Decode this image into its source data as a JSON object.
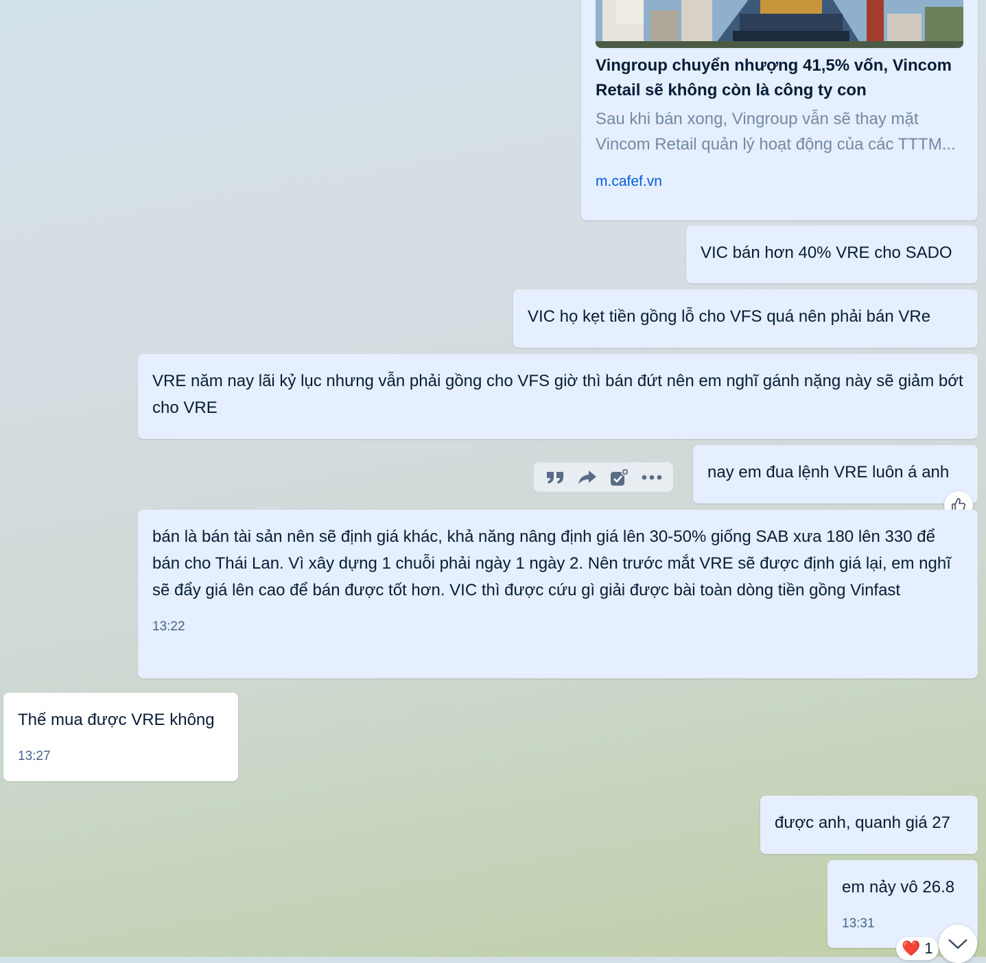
{
  "link_preview": {
    "title": "Vingroup chuyển nhượng 41,5% vốn, Vincom Retail sẽ không còn là công ty con",
    "desc_line1": "Sau khi bán xong, Vingroup vẫn sẽ thay mặt",
    "desc_line2": "Vincom Retail quản lý hoạt động của các TTTM...",
    "domain": "m.cafef.vn"
  },
  "messages": [
    {
      "text": "VIC bán hơn 40% VRE cho SADO"
    },
    {
      "text": "VIC họ kẹt tiền gồng lỗ cho VFS quá nên phải bán VRe"
    },
    {
      "text": "VRE năm nay lãi kỷ lục nhưng vẫn phải gồng cho VFS giờ thì bán đứt nên em nghĩ gánh nặng này sẽ giảm bớt cho VRE"
    },
    {
      "text": "nay em đua lệnh VRE luôn á anh"
    },
    {
      "text": "bán là bán tài sản nên sẽ định giá khác, khả năng nâng định giá lên 30-50% giống SAB xưa 180 lên 330 để bán cho Thái Lan. Vì xây dựng 1 chuỗi phải ngày 1 ngày 2. Nên trước mắt VRE sẽ được định giá lại, em nghĩ sẽ đẩy giá lên cao để bán được tốt hơn. VIC thì được cứu gì giải được bài toàn dòng tiền gồng Vinfast",
      "time": "13:22"
    },
    {
      "text": "Thế mua được VRE không",
      "time": "13:27"
    },
    {
      "text": "được anh, quanh giá 27"
    },
    {
      "text": "em nảy vô 26.8",
      "time": "13:31"
    }
  ],
  "reaction": {
    "emoji": "❤️",
    "count": "1"
  },
  "toolbar_icons": [
    "quote-icon",
    "forward-icon",
    "add-task-icon",
    "more-icon"
  ]
}
